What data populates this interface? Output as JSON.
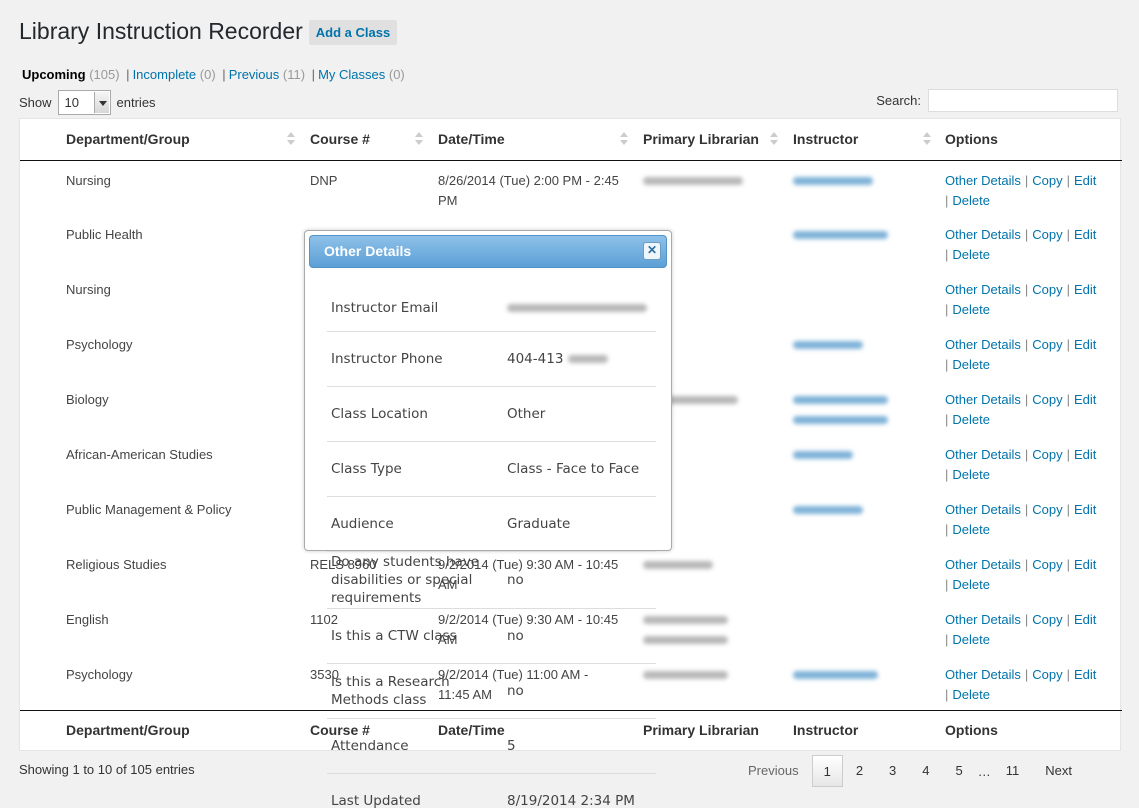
{
  "header": {
    "title": "Library Instruction Recorder",
    "add_button": "Add a Class"
  },
  "filters": [
    {
      "label": "Upcoming",
      "count": "(105)"
    },
    {
      "label": "Incomplete",
      "count": "(0)"
    },
    {
      "label": "Previous",
      "count": "(11)"
    },
    {
      "label": "My Classes",
      "count": "(0)"
    }
  ],
  "length": {
    "show": "Show",
    "value": "10",
    "entries": "entries"
  },
  "search": {
    "label": "Search:",
    "value": ""
  },
  "columns": [
    "Department/Group",
    "Course #",
    "Date/Time",
    "Primary Librarian",
    "Instructor",
    "Options"
  ],
  "rows": [
    {
      "dept": "Nursing",
      "course": "DNP",
      "date1": "8/26/2014 (Tue) 2:00 PM - 2:45",
      "date2": "PM"
    },
    {
      "dept": "Public Health",
      "course": "",
      "date1": "",
      "date2": ""
    },
    {
      "dept": "Nursing",
      "course": "",
      "date1": "",
      "date2": ""
    },
    {
      "dept": "Psychology",
      "course": "",
      "date1": "",
      "date2": ""
    },
    {
      "dept": "Biology",
      "course": "",
      "date1": "",
      "date2": ""
    },
    {
      "dept": "African-American Studies",
      "course": "",
      "date1": "",
      "date2": ""
    },
    {
      "dept": "Public Management & Policy",
      "course": "",
      "date1": "",
      "date2": ""
    },
    {
      "dept": "Religious Studies",
      "course": "RELS 8960",
      "date1": "9/2/2014 (Tue) 9:30 AM - 10:45",
      "date2": "AM"
    },
    {
      "dept": "English",
      "course": "1102",
      "date1": "9/2/2014 (Tue) 9:30 AM - 10:45",
      "date2": "AM"
    },
    {
      "dept": "Psychology",
      "course": "3530",
      "date1": "9/2/2014 (Tue) 11:00 AM -",
      "date2": "11:45 AM"
    }
  ],
  "options": {
    "details": "Other Details",
    "copy": "Copy",
    "edit": "Edit",
    "delete": "Delete",
    "sep": "|"
  },
  "info": "Showing 1 to 10 of 105 entries",
  "pagination": {
    "previous": "Previous",
    "pages": [
      "1",
      "2",
      "3",
      "4",
      "5"
    ],
    "ellipsis": "…",
    "last": "11",
    "next": "Next"
  },
  "dialog": {
    "title": "Other Details",
    "close_icon": "close-icon",
    "fields": [
      {
        "key": "Instructor Email",
        "value": ""
      },
      {
        "key": "Instructor Phone",
        "value": "404-413"
      },
      {
        "key": "Class Location",
        "value": "Other"
      },
      {
        "key": "Class Type",
        "value": "Class - Face to Face"
      },
      {
        "key": "Audience",
        "value": "Graduate"
      },
      {
        "key": "Do any students have disabilities or special requirements",
        "value": "no"
      },
      {
        "key": "Is this a CTW class",
        "value": "no"
      },
      {
        "key": "Is this a Research Methods class",
        "value": "no"
      },
      {
        "key": "Attendance",
        "value": "5"
      },
      {
        "key": "Last Updated",
        "value": "8/19/2014 2:34 PM"
      }
    ]
  }
}
